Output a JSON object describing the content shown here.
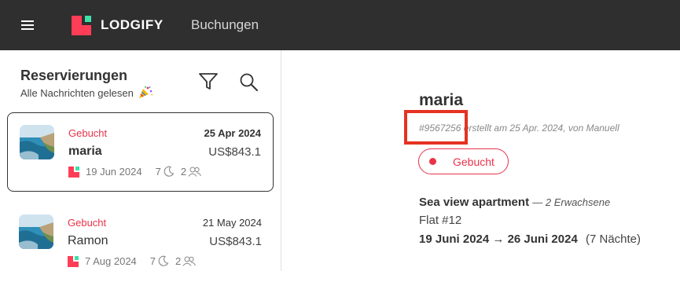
{
  "header": {
    "menu_icon": "hamburger-menu-icon",
    "logo_text": "LODGIFY",
    "nav_bookings": "Buchungen",
    "background_color": "#2f2f2f",
    "logo_color": "#ff3d57",
    "logo_accent_color": "#3ee0a8"
  },
  "sidebar": {
    "title": "Reservierungen",
    "subtitle": "Alle Nachrichten gelesen",
    "subtitle_icon": "party-popper-icon",
    "filter_icon": "filter-icon",
    "search_icon": "search-icon"
  },
  "reservations": [
    {
      "status": "Gebucht",
      "date": "25 Apr 2024",
      "guest": "maria",
      "price": "US$843.1",
      "checkin": "19 Jun 2024",
      "nights": "7",
      "guests": "2",
      "selected": true
    },
    {
      "status": "Gebucht",
      "date": "21 May 2024",
      "guest": "Ramon",
      "price": "US$843.1",
      "checkin": "7 Aug 2024",
      "nights": "7",
      "guests": "2",
      "selected": false
    }
  ],
  "detail": {
    "guest_name": "maria",
    "booking_id": "#9567256",
    "created_text": " erstellt am 25 Apr. 2024, von Manuell",
    "status": "Gebucht",
    "property_name": "Sea view apartment",
    "guests_text": "— 2 Erwachsene",
    "room": "Flat #12",
    "checkin": "19 Juni 2024",
    "arrow": "→",
    "checkout": "26 Juni 2024",
    "nights_text": "(7 Nächte)"
  },
  "colors": {
    "accent_red": "#e8334a",
    "highlight_red": "#e53222"
  }
}
